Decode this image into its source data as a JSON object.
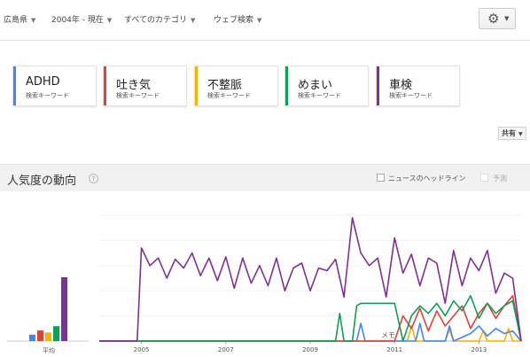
{
  "filters": [
    {
      "label": "広島県"
    },
    {
      "label": "2004年 - 現在"
    },
    {
      "label": "すべてのカテゴリ"
    },
    {
      "label": "ウェブ検索"
    }
  ],
  "gear_icon": "gear-icon",
  "terms": [
    {
      "label": "ADHD",
      "sublabel": "検索キーワード",
      "color": "#4285f4"
    },
    {
      "label": "吐き気",
      "sublabel": "検索キーワード",
      "color": "#db4437"
    },
    {
      "label": "不整脈",
      "sublabel": "検索キーワード",
      "color": "#f4b400"
    },
    {
      "label": "めまい",
      "sublabel": "検索キーワード",
      "color": "#0f9d58"
    },
    {
      "label": "車検",
      "sublabel": "検索キーワード",
      "color": "#7b3294"
    }
  ],
  "share_button": {
    "label": "共有"
  },
  "section": {
    "title": "人気度の動向",
    "help": "?",
    "news_headlines": "ニュースのヘッドライン",
    "forecast": "予測"
  },
  "chart_data": {
    "type": "line",
    "average": {
      "label": "平均",
      "values": [
        3,
        6,
        10,
        8,
        14,
        60
      ]
    },
    "x_tick_labels": [
      "2005",
      "2007",
      "2009",
      "2011",
      "2013"
    ],
    "annotation": "メモ",
    "ylim": [
      0,
      100
    ],
    "series": [
      {
        "name": "車検",
        "color": "#7b3294",
        "x": [
          2004.0,
          2004.9,
          2005.0,
          2005.2,
          2005.4,
          2005.6,
          2005.8,
          2006.0,
          2006.2,
          2006.4,
          2006.6,
          2006.8,
          2007.0,
          2007.2,
          2007.4,
          2007.6,
          2007.8,
          2008.0,
          2008.2,
          2008.4,
          2008.6,
          2008.8,
          2009.0,
          2009.2,
          2009.4,
          2009.6,
          2009.8,
          2010.0,
          2010.2,
          2010.4,
          2010.6,
          2010.8,
          2011.0,
          2011.2,
          2011.4,
          2011.6,
          2011.8,
          2012.0,
          2012.2,
          2012.4,
          2012.6,
          2012.8,
          2013.0,
          2013.2,
          2013.4,
          2013.6,
          2013.8,
          2014.0
        ],
        "values": [
          0,
          0,
          74,
          60,
          66,
          50,
          65,
          58,
          70,
          52,
          66,
          48,
          67,
          42,
          66,
          46,
          60,
          44,
          66,
          40,
          58,
          62,
          40,
          58,
          56,
          65,
          35,
          98,
          70,
          60,
          66,
          35,
          82,
          54,
          69,
          44,
          66,
          62,
          30,
          72,
          44,
          66,
          56,
          72,
          38,
          54,
          50,
          0
        ]
      },
      {
        "name": "めまい",
        "color": "#0f9d58",
        "x": [
          2004.0,
          2009.6,
          2009.7,
          2009.8,
          2009.9,
          2010.0,
          2010.1,
          2010.2,
          2010.4,
          2010.6,
          2010.8,
          2011.0,
          2011.2,
          2011.4,
          2011.6,
          2011.8,
          2012.0,
          2012.2,
          2012.4,
          2012.6,
          2012.8,
          2013.0,
          2013.2,
          2013.4,
          2013.6,
          2013.8,
          2014.0
        ],
        "values": [
          0,
          0,
          22,
          0,
          0,
          0,
          28,
          30,
          30,
          30,
          30,
          30,
          0,
          20,
          28,
          22,
          30,
          20,
          32,
          24,
          36,
          18,
          30,
          22,
          28,
          32,
          0
        ]
      },
      {
        "name": "吐き気",
        "color": "#db4437",
        "x": [
          2004.0,
          2011.0,
          2011.2,
          2011.4,
          2011.6,
          2011.8,
          2012.0,
          2012.2,
          2012.4,
          2012.6,
          2012.8,
          2013.0,
          2013.2,
          2013.4,
          2013.6,
          2013.8,
          2014.0
        ],
        "values": [
          0,
          0,
          20,
          10,
          26,
          8,
          24,
          12,
          20,
          28,
          10,
          22,
          30,
          18,
          28,
          36,
          0
        ]
      },
      {
        "name": "ADHD",
        "color": "#4285f4",
        "x": [
          2004.0,
          2010.1,
          2010.2,
          2010.3,
          2011.5,
          2011.6,
          2011.7,
          2012.2,
          2012.3,
          2012.4,
          2012.8,
          2013.0,
          2013.2,
          2013.4,
          2013.6,
          2013.8,
          2014.0
        ],
        "values": [
          0,
          0,
          14,
          0,
          0,
          14,
          0,
          0,
          12,
          0,
          6,
          12,
          4,
          10,
          6,
          8,
          0
        ]
      },
      {
        "name": "不整脈",
        "color": "#f4b400",
        "x": [
          2004.0,
          2011.3,
          2011.4,
          2011.5,
          2012.2,
          2012.3,
          2012.4,
          2013.0,
          2013.1,
          2013.2,
          2013.6,
          2013.7,
          2013.8,
          2014.0
        ],
        "values": [
          0,
          0,
          12,
          0,
          0,
          9,
          0,
          0,
          8,
          0,
          0,
          10,
          0,
          0
        ]
      }
    ]
  }
}
